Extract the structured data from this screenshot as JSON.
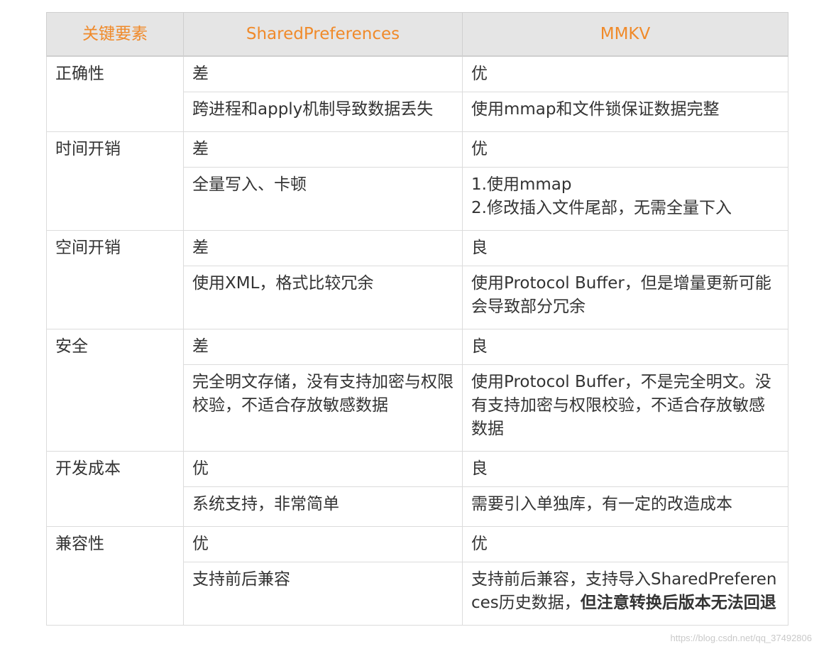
{
  "header": {
    "col1": "关键要素",
    "col2": "SharedPreferences",
    "col3": "MMKV"
  },
  "rows": [
    {
      "key": "正确性",
      "sp_rating": "差",
      "mmkv_rating": "优",
      "sp_detail": "跨进程和apply机制导致数据丢失",
      "mmkv_detail": "使用mmap和文件锁保证数据完整"
    },
    {
      "key": "时间开销",
      "sp_rating": "差",
      "mmkv_rating": "优",
      "sp_detail": "全量写入、卡顿",
      "mmkv_detail_line1": "1.使用mmap",
      "mmkv_detail_line2": "2.修改插入文件尾部，无需全量下入"
    },
    {
      "key": "空间开销",
      "sp_rating": "差",
      "mmkv_rating": "良",
      "sp_detail": "使用XML，格式比较冗余",
      "mmkv_detail": "使用Protocol Buffer，但是增量更新可能会导致部分冗余"
    },
    {
      "key": "安全",
      "sp_rating": "差",
      "mmkv_rating": "良",
      "sp_detail": "完全明文存储，没有支持加密与权限校验，不适合存放敏感数据",
      "mmkv_detail": "使用Protocol Buffer，不是完全明文。没有支持加密与权限校验，不适合存放敏感数据"
    },
    {
      "key": "开发成本",
      "sp_rating": "优",
      "mmkv_rating": "良",
      "sp_detail": "系统支持，非常简单",
      "mmkv_detail": "需要引入单独库，有一定的改造成本"
    },
    {
      "key": "兼容性",
      "sp_rating": "优",
      "mmkv_rating": "优",
      "sp_detail": "支持前后兼容",
      "mmkv_detail_normal": "支持前后兼容，支持导入SharedPreferences历史数据，",
      "mmkv_detail_bold": "但注意转换后版本无法回退"
    }
  ],
  "watermark": "https://blog.csdn.net/qq_37492806"
}
